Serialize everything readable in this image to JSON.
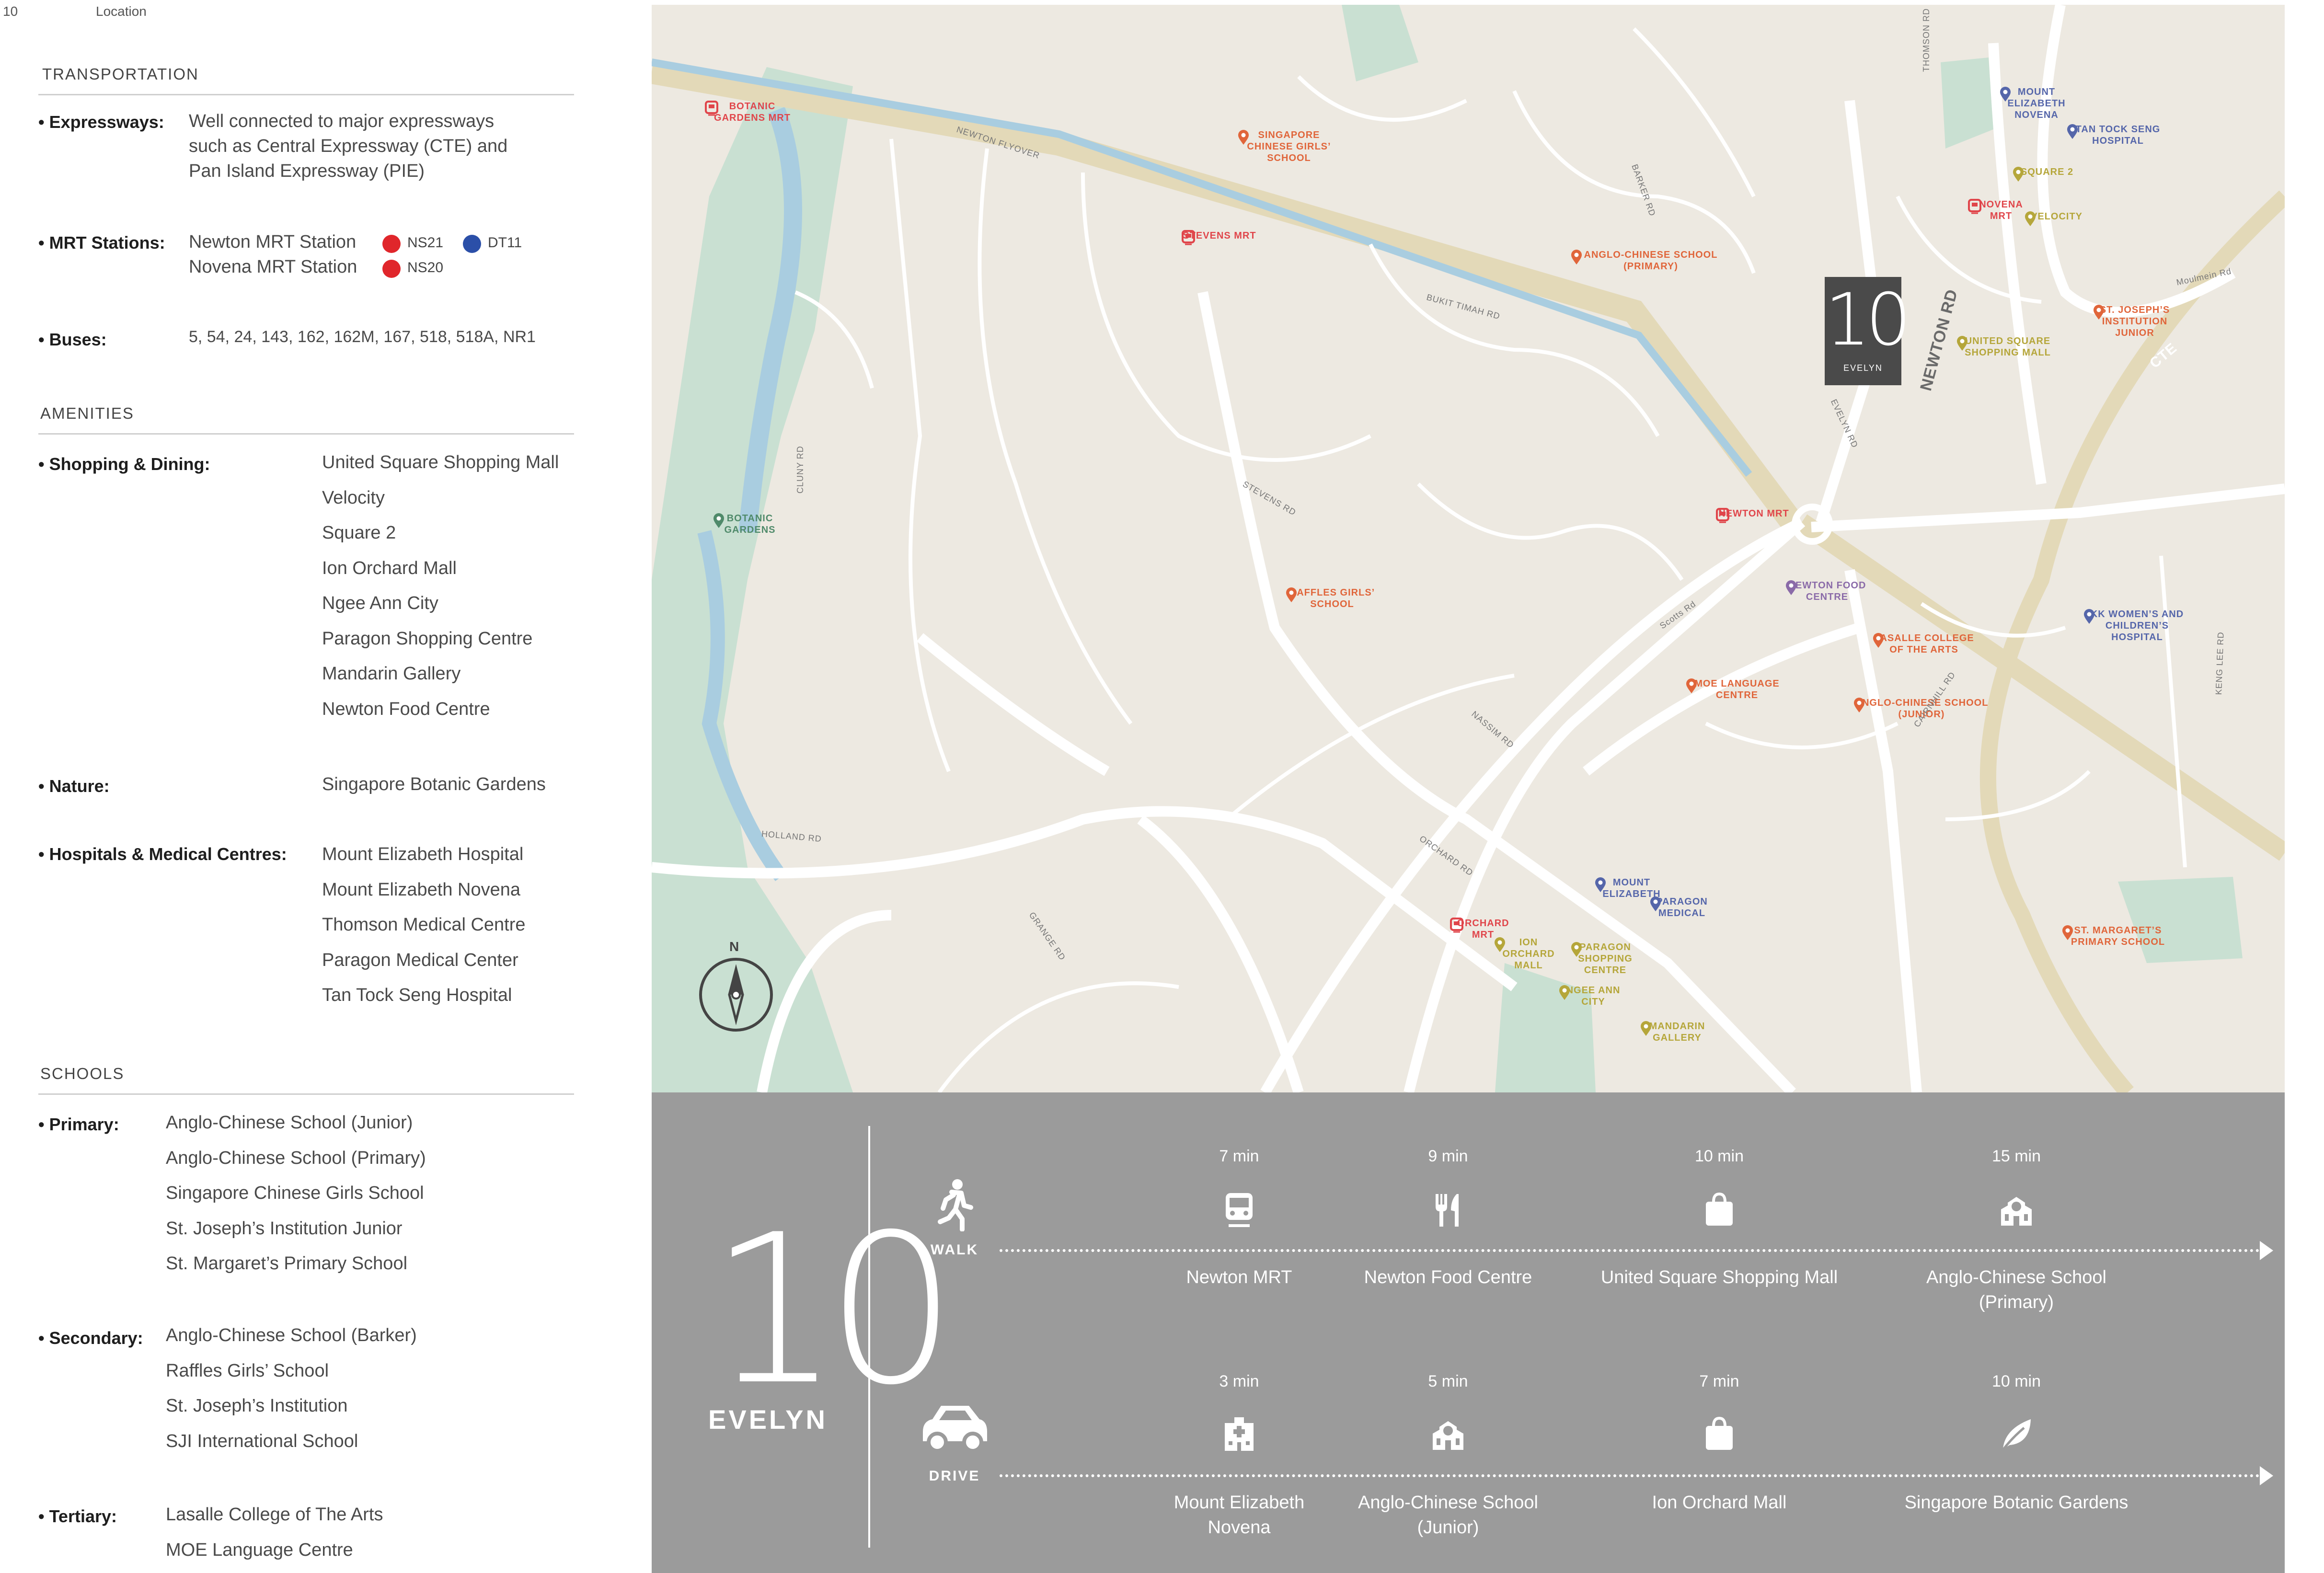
{
  "page": {
    "number": "10",
    "section": "Location"
  },
  "transportation": {
    "title": "TRANSPORTATION",
    "expressways_label": "• Expressways:",
    "expressways_lines": [
      "Well connected to major expressways",
      "such as Central Expressway (CTE) and",
      "Pan Island Expressway (PIE)"
    ],
    "mrt_label": "• MRT Stations:",
    "mrt": [
      {
        "name": "Newton MRT Station",
        "codes": [
          {
            "code": "NS21",
            "color": "#e0262b"
          },
          {
            "code": "DT11",
            "color": "#2b4fa8"
          }
        ]
      },
      {
        "name": "Novena MRT Station",
        "codes": [
          {
            "code": "NS20",
            "color": "#e0262b"
          }
        ]
      }
    ],
    "buses_label": "• Buses:",
    "buses": "5, 54, 24, 143, 162, 162M, 167, 518, 518A, NR1"
  },
  "amenities": {
    "title": "AMENITIES",
    "shopping_label": "• Shopping & Dining:",
    "shopping": [
      "United Square Shopping Mall",
      "Velocity",
      "Square 2",
      "Ion Orchard Mall",
      "Ngee Ann City",
      "Paragon Shopping Centre",
      "Mandarin Gallery",
      "Newton Food Centre"
    ],
    "nature_label": "• Nature:",
    "nature": [
      "Singapore Botanic Gardens"
    ],
    "hospitals_label": "• Hospitals & Medical Centres:",
    "hospitals": [
      "Mount Elizabeth Hospital",
      "Mount Elizabeth Novena",
      "Thomson Medical Centre",
      "Paragon Medical Center",
      "Tan Tock Seng Hospital"
    ]
  },
  "schools": {
    "title": "SCHOOLS",
    "primary_label": "• Primary:",
    "primary": [
      "Anglo-Chinese School (Junior)",
      "Anglo-Chinese School (Primary)",
      "Singapore Chinese Girls School",
      "St. Joseph’s Institution Junior",
      "St. Margaret’s Primary School"
    ],
    "secondary_label": "• Secondary:",
    "secondary": [
      "Anglo-Chinese School (Barker)",
      "Raffles Girls’ School",
      "St. Joseph’s Institution",
      "SJI International School"
    ],
    "tertiary_label": "• Tertiary:",
    "tertiary": [
      "Lasalle College of The Arts",
      "MOE Language Centre"
    ]
  },
  "map": {
    "logo_number": "10",
    "logo_text": "EVELYN",
    "compass": "N",
    "colors": {
      "mrt": "#e0454a",
      "school": "#e0653a",
      "mall": "#b5a63a",
      "hospital": "#5566aa",
      "park": "#4f8a6a",
      "food": "#8a6aa8",
      "land": "#ede9e1",
      "road": "#ffffff",
      "green": "#c9e0d2",
      "canal": "#a9cde0"
    },
    "pois": [
      {
        "label": "BOTANIC GARDENS MRT",
        "type": "mrt"
      },
      {
        "label": "SINGAPORE CHINESE GIRLS’ SCHOOL",
        "type": "school"
      },
      {
        "label": "STEVENS MRT",
        "type": "mrt"
      },
      {
        "label": "ANGLO-CHINESE SCHOOL (PRIMARY)",
        "type": "school"
      },
      {
        "label": "MOUNT ELIZABETH NOVENA",
        "type": "hospital"
      },
      {
        "label": "TAN TOCK SENG HOSPITAL",
        "type": "hospital"
      },
      {
        "label": "SQUARE 2",
        "type": "mall"
      },
      {
        "label": "NOVENA MRT",
        "type": "mrt"
      },
      {
        "label": "VELOCITY",
        "type": "mall"
      },
      {
        "label": "UNITED SQUARE SHOPPING MALL",
        "type": "mall"
      },
      {
        "label": "ST. JOSEPH’S INSTITUTION JUNIOR",
        "type": "school"
      },
      {
        "label": "BOTANIC GARDENS",
        "type": "park"
      },
      {
        "label": "NEWTON MRT",
        "type": "mrt"
      },
      {
        "label": "NEWTON FOOD CENTRE",
        "type": "food"
      },
      {
        "label": "RAFFLES GIRLS’ SCHOOL",
        "type": "school"
      },
      {
        "label": "KK WOMEN’S AND CHILDREN’S HOSPITAL",
        "type": "hospital"
      },
      {
        "label": "LASALLE COLLEGE OF THE ARTS",
        "type": "school"
      },
      {
        "label": "MOE LANGUAGE CENTRE",
        "type": "school"
      },
      {
        "label": "ANGLO-CHINESE SCHOOL (JUNIOR)",
        "type": "school"
      },
      {
        "label": "MOUNT ELIZABETH",
        "type": "hospital"
      },
      {
        "label": "PARAGON MEDICAL",
        "type": "hospital"
      },
      {
        "label": "ORCHARD MRT",
        "type": "mrt"
      },
      {
        "label": "ION ORCHARD MALL",
        "type": "mall"
      },
      {
        "label": "PARAGON SHOPPING CENTRE",
        "type": "mall"
      },
      {
        "label": "NGEE ANN CITY",
        "type": "mall"
      },
      {
        "label": "MANDARIN GALLERY",
        "type": "mall"
      },
      {
        "label": "ST. MARGARET’S PRIMARY SCHOOL",
        "type": "school"
      }
    ],
    "roads": [
      "NEWTON FLYOVER",
      "BUKIT TIMAH RD",
      "BARKER RD",
      "THOMSON RD",
      "Moulmein Rd",
      "NEWTON RD",
      "EVELYN RD",
      "CTE",
      "STEVENS RD",
      "CLUNY RD",
      "Scotts Rd",
      "NASSIM RD",
      "HOLLAND RD",
      "ORCHARD RD",
      "GRANGE RD",
      "CAIRNHILL RD",
      "KENG LEE RD"
    ]
  },
  "panel": {
    "logo_number": "10",
    "logo_text": "EVELYN",
    "walk": {
      "label": "WALK",
      "icon": "walking-person-icon",
      "destinations": [
        {
          "mins": "7 min",
          "name": [
            "Newton MRT"
          ],
          "icon": "train-icon"
        },
        {
          "mins": "9 min",
          "name": [
            "Newton Food Centre"
          ],
          "icon": "fork-knife-icon"
        },
        {
          "mins": "10 min",
          "name": [
            "United Square Shopping Mall"
          ],
          "icon": "shopping-bag-icon"
        },
        {
          "mins": "15 min",
          "name": [
            "Anglo-Chinese School",
            "(Primary)"
          ],
          "icon": "school-icon"
        }
      ]
    },
    "drive": {
      "label": "DRIVE",
      "icon": "car-icon",
      "destinations": [
        {
          "mins": "3 min",
          "name": [
            "Mount Elizabeth",
            "Novena"
          ],
          "icon": "hospital-icon"
        },
        {
          "mins": "5 min",
          "name": [
            "Anglo-Chinese School",
            "(Junior)"
          ],
          "icon": "school-icon"
        },
        {
          "mins": "7 min",
          "name": [
            "Ion Orchard Mall"
          ],
          "icon": "shopping-bag-icon"
        },
        {
          "mins": "10 min",
          "name": [
            "Singapore Botanic Gardens"
          ],
          "icon": "leaf-icon"
        }
      ]
    }
  }
}
